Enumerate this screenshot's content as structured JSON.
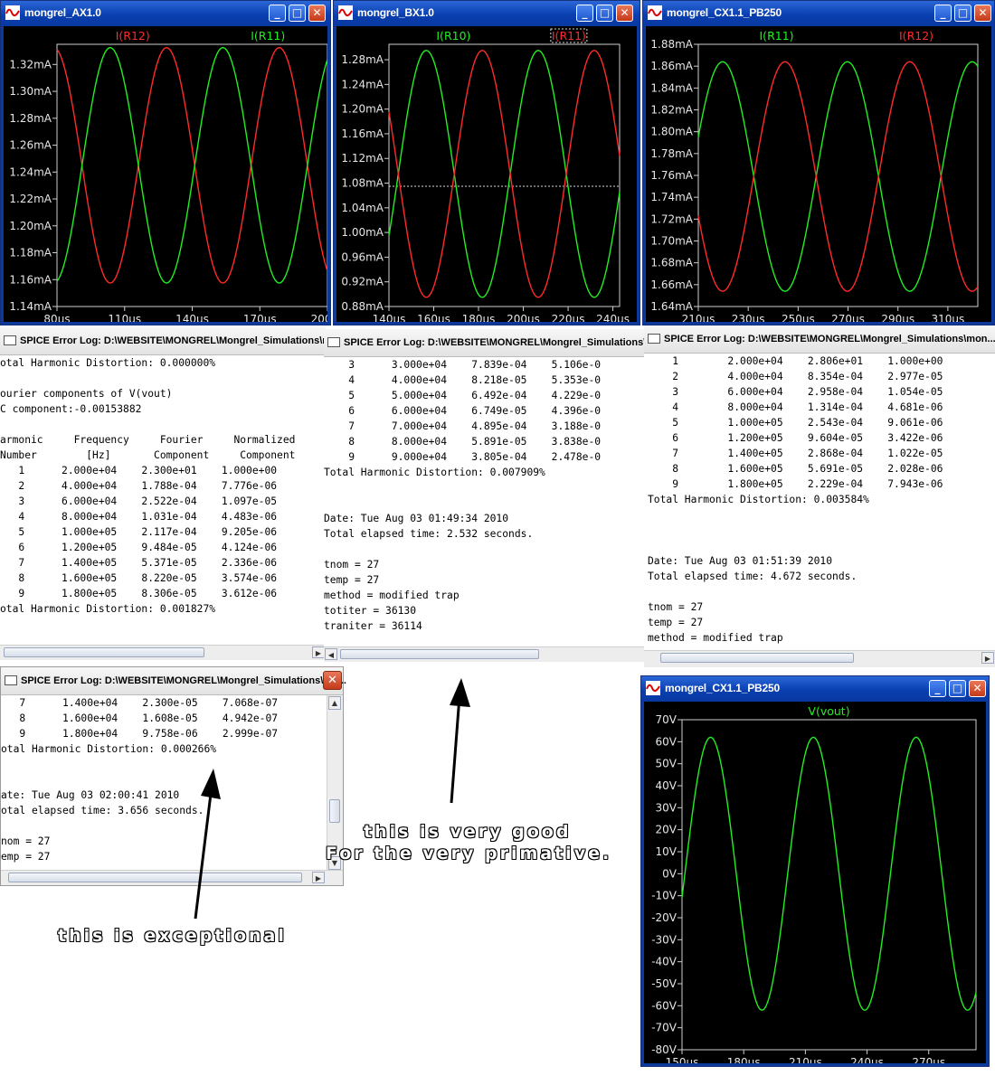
{
  "plot_windows": [
    {
      "id": "ax",
      "title": "mongrel_AX1.0",
      "legend": [
        {
          "label": "I(R12)",
          "color": "#ff2a2a"
        },
        {
          "label": "I(R11)",
          "color": "#22ee22"
        }
      ]
    },
    {
      "id": "bx",
      "title": "mongrel_BX1.0",
      "legend": [
        {
          "label": "I(R10)",
          "color": "#22ee22"
        },
        {
          "label": "I(R11)",
          "color": "#ff2a2a",
          "boxed": true
        }
      ]
    },
    {
      "id": "cx",
      "title": "mongrel_CX1.1_PB250",
      "legend": [
        {
          "label": "I(R11)",
          "color": "#22ee22"
        },
        {
          "label": "I(R12)",
          "color": "#ff2a2a"
        }
      ]
    },
    {
      "id": "cv",
      "title": "mongrel_CX1.1_PB250",
      "legend": [
        {
          "label": "V(vout)",
          "color": "#22ee22"
        }
      ]
    }
  ],
  "chart_data": [
    {
      "type": "line",
      "id": "ax",
      "x_ticks": [
        "80µs",
        "110µs",
        "140µs",
        "170µs",
        "200µs"
      ],
      "y_ticks": [
        "1.32mA",
        "1.30mA",
        "1.28mA",
        "1.26mA",
        "1.24mA",
        "1.22mA",
        "1.20mA",
        "1.18mA",
        "1.16mA",
        "1.14mA"
      ],
      "xlim": [
        80,
        200
      ],
      "ylim": [
        1.14,
        1.335
      ],
      "series": [
        {
          "name": "I(R12)",
          "color": "#ff2a2a",
          "center": 1.245,
          "amplitude": 0.0875,
          "period_us": 50,
          "phase_deg": 100
        },
        {
          "name": "I(R11)",
          "color": "#22ee22",
          "center": 1.245,
          "amplitude": 0.0875,
          "period_us": 50,
          "phase_deg": 280
        }
      ]
    },
    {
      "type": "line",
      "id": "bx",
      "x_ticks": [
        "140µs",
        "160µs",
        "180µs",
        "200µs",
        "220µs",
        "240µs"
      ],
      "y_ticks": [
        "1.28mA",
        "1.24mA",
        "1.20mA",
        "1.16mA",
        "1.12mA",
        "1.08mA",
        "1.04mA",
        "1.00mA",
        "0.96mA",
        "0.92mA",
        "0.88mA"
      ],
      "xlim": [
        140,
        243
      ],
      "ylim": [
        0.88,
        1.305
      ],
      "series": [
        {
          "name": "I(R10)",
          "color": "#22ee22",
          "center": 1.095,
          "amplitude": 0.2,
          "period_us": 50,
          "phase_deg": 330
        },
        {
          "name": "I(R11)",
          "color": "#ff2a2a",
          "center": 1.095,
          "amplitude": 0.2,
          "period_us": 50,
          "phase_deg": 150
        }
      ]
    },
    {
      "type": "line",
      "id": "cx",
      "x_ticks": [
        "210µs",
        "230µs",
        "250µs",
        "270µs",
        "290µs",
        "310µs"
      ],
      "y_ticks": [
        "1.88mA",
        "1.86mA",
        "1.84mA",
        "1.82mA",
        "1.80mA",
        "1.78mA",
        "1.76mA",
        "1.74mA",
        "1.72mA",
        "1.70mA",
        "1.68mA",
        "1.66mA",
        "1.64mA"
      ],
      "xlim": [
        210,
        322
      ],
      "ylim": [
        1.64,
        1.88
      ],
      "series": [
        {
          "name": "I(R11)",
          "color": "#22ee22",
          "center": 1.759,
          "amplitude": 0.105,
          "period_us": 50,
          "phase_deg": 20
        },
        {
          "name": "I(R12)",
          "color": "#ff2a2a",
          "center": 1.759,
          "amplitude": 0.105,
          "period_us": 50,
          "phase_deg": 200
        }
      ]
    },
    {
      "type": "line",
      "id": "cv",
      "x_ticks": [
        "150µs",
        "180µs",
        "210µs",
        "240µs",
        "270µs"
      ],
      "y_ticks": [
        "70V",
        "60V",
        "50V",
        "40V",
        "30V",
        "20V",
        "10V",
        "0V",
        "-10V",
        "-20V",
        "-30V",
        "-40V",
        "-50V",
        "-60V",
        "-70V",
        "-80V"
      ],
      "xlim": [
        150,
        293
      ],
      "ylim": [
        -80,
        70
      ],
      "series": [
        {
          "name": "V(vout)",
          "color": "#22ee22",
          "center": 0,
          "amplitude": 62,
          "period_us": 50,
          "phase_deg": 350
        }
      ]
    }
  ],
  "logs": [
    {
      "id": "log1",
      "title": "SPICE Error Log: D:\\WEBSITE\\MONGREL\\Mongrel_Simulations\\mon...",
      "lines": [
        "otal Harmonic Distortion: 0.000000%",
        "",
        "ourier components of V(vout)",
        "C component:-0.00153882",
        "",
        "armonic     Frequency     Fourier     Normalized",
        "Number        [Hz]       Component     Component",
        "   1      2.000e+04    2.300e+01    1.000e+00",
        "   2      4.000e+04    1.788e-04    7.776e-06",
        "   3      6.000e+04    2.522e-04    1.097e-05",
        "   4      8.000e+04    1.031e-04    4.483e-06",
        "   5      1.000e+05    2.117e-04    9.205e-06",
        "   6      1.200e+05    9.484e-05    4.124e-06",
        "   7      1.400e+05    5.371e-05    2.336e-06",
        "   8      1.600e+05    8.220e-05    3.574e-06",
        "   9      1.800e+05    8.306e-05    3.612e-06",
        "otal Harmonic Distortion: 0.001827%"
      ]
    },
    {
      "id": "log2",
      "title": "SPICE Error Log: D:\\WEBSITE\\MONGREL\\Mongrel_Simulations\\mon",
      "lines": [
        "    3      3.000e+04    7.839e-04    5.106e-0",
        "    4      4.000e+04    8.218e-05    5.353e-0",
        "    5      5.000e+04    6.492e-04    4.229e-0",
        "    6      6.000e+04    6.749e-05    4.396e-0",
        "    7      7.000e+04    4.895e-04    3.188e-0",
        "    8      8.000e+04    5.891e-05    3.838e-0",
        "    9      9.000e+04    3.805e-04    2.478e-0",
        "Total Harmonic Distortion: 0.007909%",
        "",
        "",
        "Date: Tue Aug 03 01:49:34 2010",
        "Total elapsed time: 2.532 seconds.",
        "",
        "tnom = 27",
        "temp = 27",
        "method = modified trap",
        "totiter = 36130",
        "traniter = 36114"
      ]
    },
    {
      "id": "log3",
      "title": "SPICE Error Log: D:\\WEBSITE\\MONGREL\\Mongrel_Simulations\\mon...",
      "lines": [
        "    1        2.000e+04    2.806e+01    1.000e+00",
        "    2        4.000e+04    8.354e-04    2.977e-05",
        "    3        6.000e+04    2.958e-04    1.054e-05",
        "    4        8.000e+04    1.314e-04    4.681e-06",
        "    5        1.000e+05    2.543e-04    9.061e-06",
        "    6        1.200e+05    9.604e-05    3.422e-06",
        "    7        1.400e+05    2.868e-04    1.022e-05",
        "    8        1.600e+05    5.691e-05    2.028e-06",
        "    9        1.800e+05    2.229e-04    7.943e-06",
        "Total Harmonic Distortion: 0.003584%",
        "",
        "",
        "",
        "Date: Tue Aug 03 01:51:39 2010",
        "Total elapsed time: 4.672 seconds.",
        "",
        "tnom = 27",
        "temp = 27",
        "method = modified trap"
      ]
    },
    {
      "id": "log4",
      "title": "SPICE Error Log: D:\\WEBSITE\\MONGREL\\Mongrel_Simulations\\mo...",
      "lines": [
        "   7      1.400e+04    2.300e-05    7.068e-07",
        "   8      1.600e+04    1.608e-05    4.942e-07",
        "   9      1.800e+04    9.758e-06    2.999e-07",
        "otal Harmonic Distortion: 0.000266%",
        "",
        "",
        "ate: Tue Aug 03 02:00:41 2010",
        "otal elapsed time: 3.656 seconds.",
        "",
        "nom = 27",
        "emp = 27"
      ]
    }
  ],
  "annotations": {
    "bx_line1": "this is very good",
    "bx_line2": "For the very primative.",
    "log4_note": "this is exceptional"
  }
}
